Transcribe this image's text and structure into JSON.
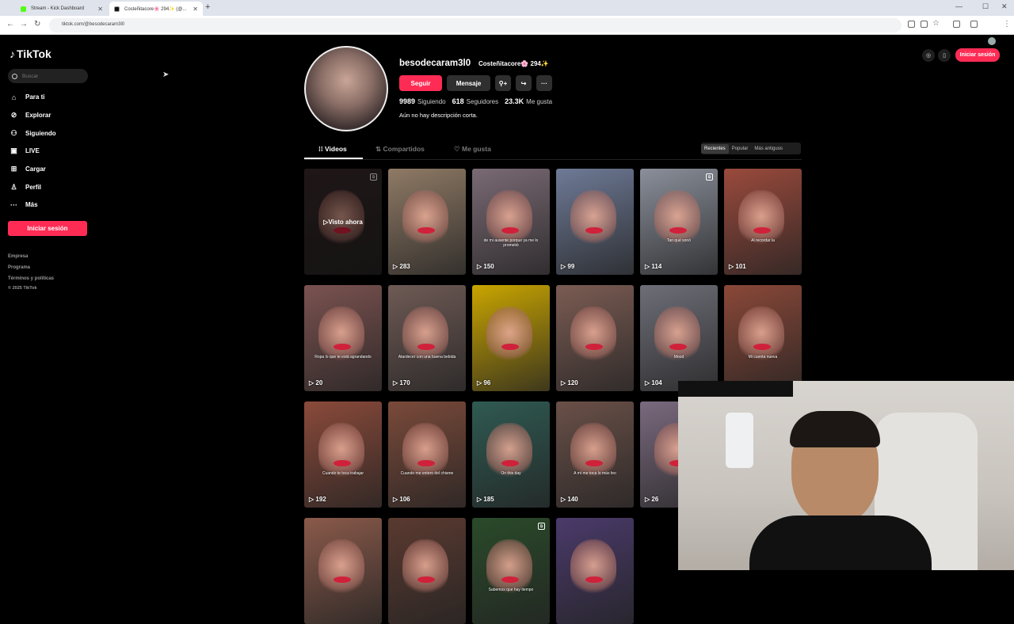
{
  "browser": {
    "tabs": [
      {
        "title": "Stream - Kick Dashboard",
        "favicon_color": "#53fc18"
      },
      {
        "title": "Costeñitacore🌸 294✨ (@...",
        "favicon_color": "#000000"
      }
    ],
    "url": "tiktok.com/@besodecaram3l0"
  },
  "sidebar": {
    "logo": "TikTok",
    "search_placeholder": "Buscar",
    "nav": [
      {
        "label": "Para ti",
        "icon": "home-icon"
      },
      {
        "label": "Explorar",
        "icon": "compass-icon"
      },
      {
        "label": "Siguiendo",
        "icon": "following-icon"
      },
      {
        "label": "LIVE",
        "icon": "live-icon"
      },
      {
        "label": "Cargar",
        "icon": "upload-icon"
      },
      {
        "label": "Perfil",
        "icon": "profile-icon"
      },
      {
        "label": "Más",
        "icon": "more-icon"
      }
    ],
    "login": "Iniciar sesión",
    "footer": [
      "Empresa",
      "Programa",
      "Términos y políticas",
      "© 2025 TikTok"
    ]
  },
  "profile": {
    "username": "besodecaram3l0",
    "nickname": "Costeñitacore🌸 294✨",
    "follow": "Seguir",
    "message": "Mensaje",
    "stats": [
      {
        "value": "9989",
        "label": "Siguiendo"
      },
      {
        "value": "618",
        "label": "Seguidores"
      },
      {
        "value": "23.3K",
        "label": "Me gusta"
      }
    ],
    "bio": "Aún no hay descripción corta."
  },
  "header": {
    "login": "Iniciar sesión"
  },
  "tabs": {
    "videos": "Videos",
    "reposts": "Compartidos",
    "liked": "Me gusta"
  },
  "sort": [
    "Recientes",
    "Popular",
    "Más antiguos"
  ],
  "videos": [
    {
      "views": "",
      "watched": "Visto ahora",
      "pinned": true,
      "bg": "#3a2a2a"
    },
    {
      "views": "283",
      "bg": "#8f7a65"
    },
    {
      "views": "150",
      "bg": "#7a6a74",
      "caption": "de mi ausente porque ya me lo prometió"
    },
    {
      "views": "99",
      "bg": "#6e7a96"
    },
    {
      "views": "114",
      "pinned": true,
      "bg": "#8a8f9a",
      "caption": "Tan qué sonó"
    },
    {
      "views": "101",
      "bg": "#9a4a3c",
      "caption": "Al recordar la"
    },
    {
      "views": "20",
      "bg": "#7a5250",
      "caption": "Ropa lo que te está agrandando"
    },
    {
      "views": "170",
      "bg": "#6e5a55",
      "caption": "Atardecer con una buena bebida"
    },
    {
      "views": "96",
      "bg": "#c9a500"
    },
    {
      "views": "120",
      "bg": "#7b5c53"
    },
    {
      "views": "104",
      "bg": "#6e6e78",
      "caption": "Mood"
    },
    {
      "views": "",
      "bg": "#8a4838",
      "caption": "Mi cuenta nueva"
    },
    {
      "views": "192",
      "bg": "#8a4a3a",
      "caption": "Cuando te toca trabajar"
    },
    {
      "views": "106",
      "bg": "#7a4a3a",
      "caption": "Cuando me entero del chisme"
    },
    {
      "views": "185",
      "bg": "#2f5a52",
      "caption": "On this day"
    },
    {
      "views": "140",
      "bg": "#6a5048",
      "caption": "A mí me toca lo más feo"
    },
    {
      "views": "26",
      "bg": "#7a6a7e"
    },
    {
      "views": "",
      "pinned": true,
      "bg": "#8a4a4a"
    },
    {
      "views": "",
      "bg": "#8a5a4a"
    },
    {
      "views": "",
      "bg": "#5a3a30"
    },
    {
      "views": "",
      "pinned": true,
      "bg": "#2a4a2a",
      "caption": "Sabemos que hay tiempo"
    },
    {
      "views": "",
      "bg": "#4a3a6a"
    }
  ]
}
